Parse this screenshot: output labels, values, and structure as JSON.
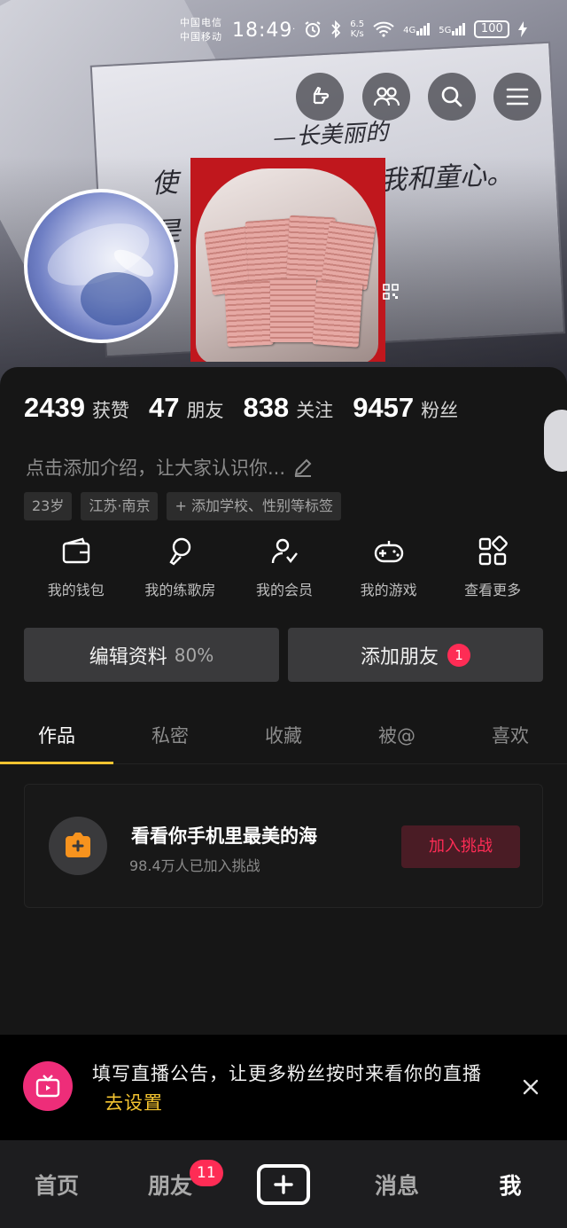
{
  "status_bar": {
    "carrier_1": "中国电信",
    "carrier_2": "中国移动",
    "time": "18:49",
    "net_speed_value": "6.5",
    "net_speed_unit": "K/s",
    "sig_1_label": "4G",
    "sig_2_label": "5G",
    "battery": "100"
  },
  "profile": {
    "stats": [
      {
        "value": "2439",
        "label": "获赞"
      },
      {
        "value": "47",
        "label": "朋友"
      },
      {
        "value": "838",
        "label": "关注"
      },
      {
        "value": "9457",
        "label": "粉丝"
      }
    ],
    "bio_placeholder": "点击添加介绍，让大家认识你...",
    "tags": [
      "23岁",
      "江苏·南京",
      "添加学校、性别等标签"
    ],
    "tag_add_symbol": "+"
  },
  "shortcuts": [
    {
      "label": "我的钱包",
      "icon": "wallet-icon"
    },
    {
      "label": "我的练歌房",
      "icon": "microphone-icon"
    },
    {
      "label": "我的会员",
      "icon": "member-icon"
    },
    {
      "label": "我的游戏",
      "icon": "gamepad-icon"
    },
    {
      "label": "查看更多",
      "icon": "grid-more-icon"
    }
  ],
  "actions": {
    "edit_profile": "编辑资料",
    "edit_profile_percent": "80%",
    "add_friends": "添加朋友",
    "add_friends_badge": "1"
  },
  "tabs": [
    "作品",
    "私密",
    "收藏",
    "被@",
    "喜欢"
  ],
  "challenge": {
    "title": "看看你手机里最美的海",
    "subtitle": "98.4万人已加入挑战",
    "button": "加入挑战"
  },
  "live_notice": {
    "text": "填写直播公告，让更多粉丝按时来看你的直播",
    "link": "去设置"
  },
  "bottom_nav": {
    "home": "首页",
    "friends": "朋友",
    "friends_badge": "11",
    "messages": "消息",
    "me": "我"
  },
  "colors": {
    "accent_red": "#fe2c55",
    "accent_yellow": "#f4c430",
    "live_pink": "#ee2d79",
    "panel_bg": "#161616"
  }
}
